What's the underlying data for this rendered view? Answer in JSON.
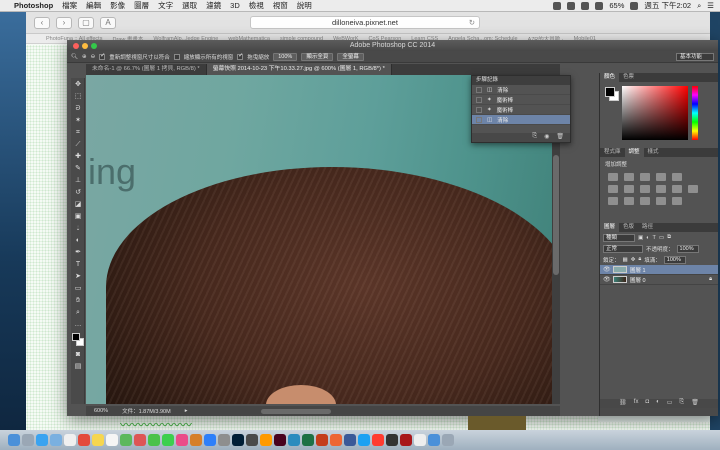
{
  "menubar": {
    "app_name": "Photoshop",
    "items": [
      "檔案",
      "編輯",
      "影像",
      "圖層",
      "文字",
      "選取",
      "濾鏡",
      "3D",
      "檢視",
      "視窗",
      "說明"
    ],
    "battery": "65%",
    "clock": "週五 下午2:02"
  },
  "browser": {
    "url": "dilloneiva.pixnet.net",
    "bookmarks": [
      "PhotoFuna :: All effects",
      "Draw 畫畫本",
      "WolframAlp...ledge Engine",
      "webMathematica",
      "simple compound",
      "WeBWorK",
      "CoS Pearson",
      "Learn CSS",
      "Angela Scha...om: Schedule",
      "A7R的大冒險 ·",
      "Mobile01"
    ]
  },
  "photoshop": {
    "window_title": "Adobe Photoshop CC 2014",
    "options": {
      "resize_windows": "重新調整視窗尺寸以符合",
      "zoom_all": "縮放顯示所有的視窗",
      "scrubby_zoom": "拖曳縮放",
      "btn_100": "100%",
      "btn_fit": "顯示全頁",
      "btn_fill": "全螢幕",
      "workspace": "基本功能"
    },
    "tabs": [
      {
        "label": "未命名-1 @ 66.7% (圖層 1 拷貝, RGB/8) *",
        "active": false
      },
      {
        "label": "螢幕快照 2014-10-23 下午10.33.27.jpg @ 600% (圖層 1, RGB/8*) *",
        "active": true
      }
    ],
    "canvas_text": "ing",
    "status": {
      "zoom": "600%",
      "doc_size": "文件：1.87M/3.90M"
    },
    "history": {
      "title": "步驟記錄",
      "rows": [
        "清除",
        "魔術棒",
        "魔術棒",
        "清除"
      ]
    },
    "panels": {
      "color_tabs": [
        "顏色",
        "色票"
      ],
      "adjust_tabs": [
        "程式庫",
        "調整",
        "樣式"
      ],
      "adjust_label": "增加調整",
      "layer_tabs": [
        "圖層",
        "色版",
        "路徑"
      ],
      "kind_label": "種類",
      "blend_mode": "正常",
      "opacity_label": "不透明度：",
      "opacity_value": "100%",
      "lock_label": "鎖定：",
      "fill_label": "填滿：",
      "fill_value": "100%",
      "layers": [
        {
          "name": "圖層 1",
          "active": true
        },
        {
          "name": "圖層 0",
          "active": false
        }
      ]
    }
  },
  "colors": {
    "ps_bg": "#535353",
    "selection": "#6d84a8"
  }
}
